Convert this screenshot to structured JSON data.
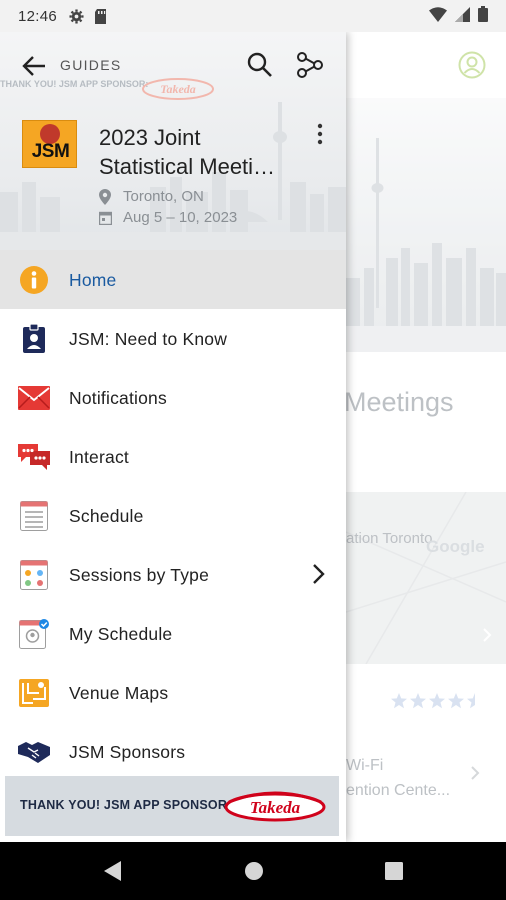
{
  "status_bar": {
    "time": "12:46"
  },
  "drawer": {
    "header": {
      "section_label": "GUIDES",
      "sponsor_ghost_text": "THANK YOU! JSM APP SPONSOR:",
      "logo_text": "JSM",
      "title_line1": "2023 Joint",
      "title_line2": "Statistical Meeti…",
      "location": "Toronto, ON",
      "dates": "Aug 5 – 10, 2023"
    },
    "menu": [
      {
        "label": "Home",
        "icon": "info-icon",
        "active": true
      },
      {
        "label": "JSM: Need to Know",
        "icon": "badge-icon"
      },
      {
        "label": "Notifications",
        "icon": "envelope-icon"
      },
      {
        "label": "Interact",
        "icon": "chat-bubbles-icon"
      },
      {
        "label": "Schedule",
        "icon": "schedule-list-icon"
      },
      {
        "label": "Sessions by Type",
        "icon": "session-types-icon",
        "has_submenu": true
      },
      {
        "label": "My Schedule",
        "icon": "my-schedule-icon"
      },
      {
        "label": "Venue Maps",
        "icon": "map-icon"
      },
      {
        "label": "JSM Sponsors",
        "icon": "handshake-icon"
      }
    ],
    "sponsor_banner": {
      "text": "THANK YOU! JSM APP SPONSOR:",
      "brand": "Takeda"
    }
  },
  "background": {
    "title_fragment": "Meetings",
    "map_text": "ation Toronto",
    "map_brand": "Google",
    "rating_stars": 4.5,
    "info_line1": "Wi-Fi",
    "info_line2": "ention Cente..."
  },
  "colors": {
    "accent": "#1a5aa0",
    "active_bg": "#e4e4e4",
    "info_icon": "#f5a623",
    "envelope": "#e53935",
    "brand_red": "#d0021b"
  }
}
